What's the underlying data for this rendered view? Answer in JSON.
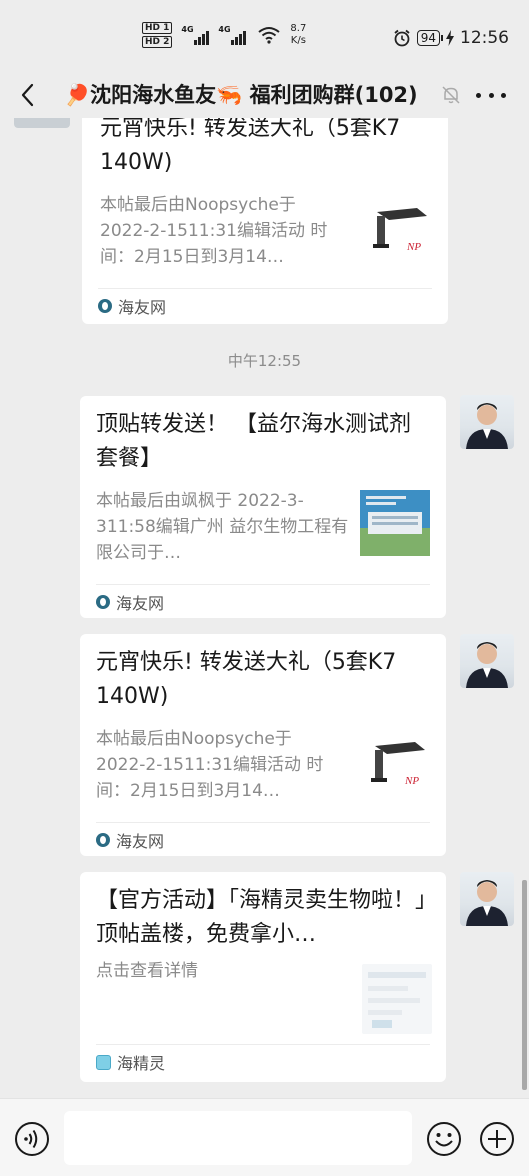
{
  "status_bar": {
    "hd1": "HD 1",
    "hd2": "HD 2",
    "net1": "4G",
    "net2": "4G",
    "speed_value": "8.7",
    "speed_unit": "K/s",
    "battery": "94",
    "time": "12:56"
  },
  "header": {
    "title": "🏓沈阳海水鱼友🦐 福利团购群(102)"
  },
  "messages": [
    {
      "title": "元宵快乐! 转发送大礼（5套K7 140W)",
      "desc": "本帖最后由Noopsyche于 2022-2-1511:31编辑活动 时间：2月15日到3月14…",
      "source": "海友网"
    },
    {
      "timestamp": "中午12:55"
    },
    {
      "title": "顶贴转发送！ 【益尔海水测试剂套餐】",
      "desc": "本帖最后由飒枫于 2022-3-311:58编辑广州 益尔生物工程有限公司于…",
      "source": "海友网"
    },
    {
      "title": "元宵快乐! 转发送大礼（5套K7 140W)",
      "desc": "本帖最后由Noopsyche于 2022-2-1511:31编辑活动 时间：2月15日到3月14…",
      "source": "海友网"
    },
    {
      "title": "【官方活动】「海精灵卖生物啦！」顶帖盖楼，免费拿小…",
      "desc": "点击查看详情",
      "source": "海精灵"
    }
  ],
  "colors": {
    "background": "#ededed",
    "card": "#ffffff",
    "desc_text": "#8a8a8a"
  }
}
